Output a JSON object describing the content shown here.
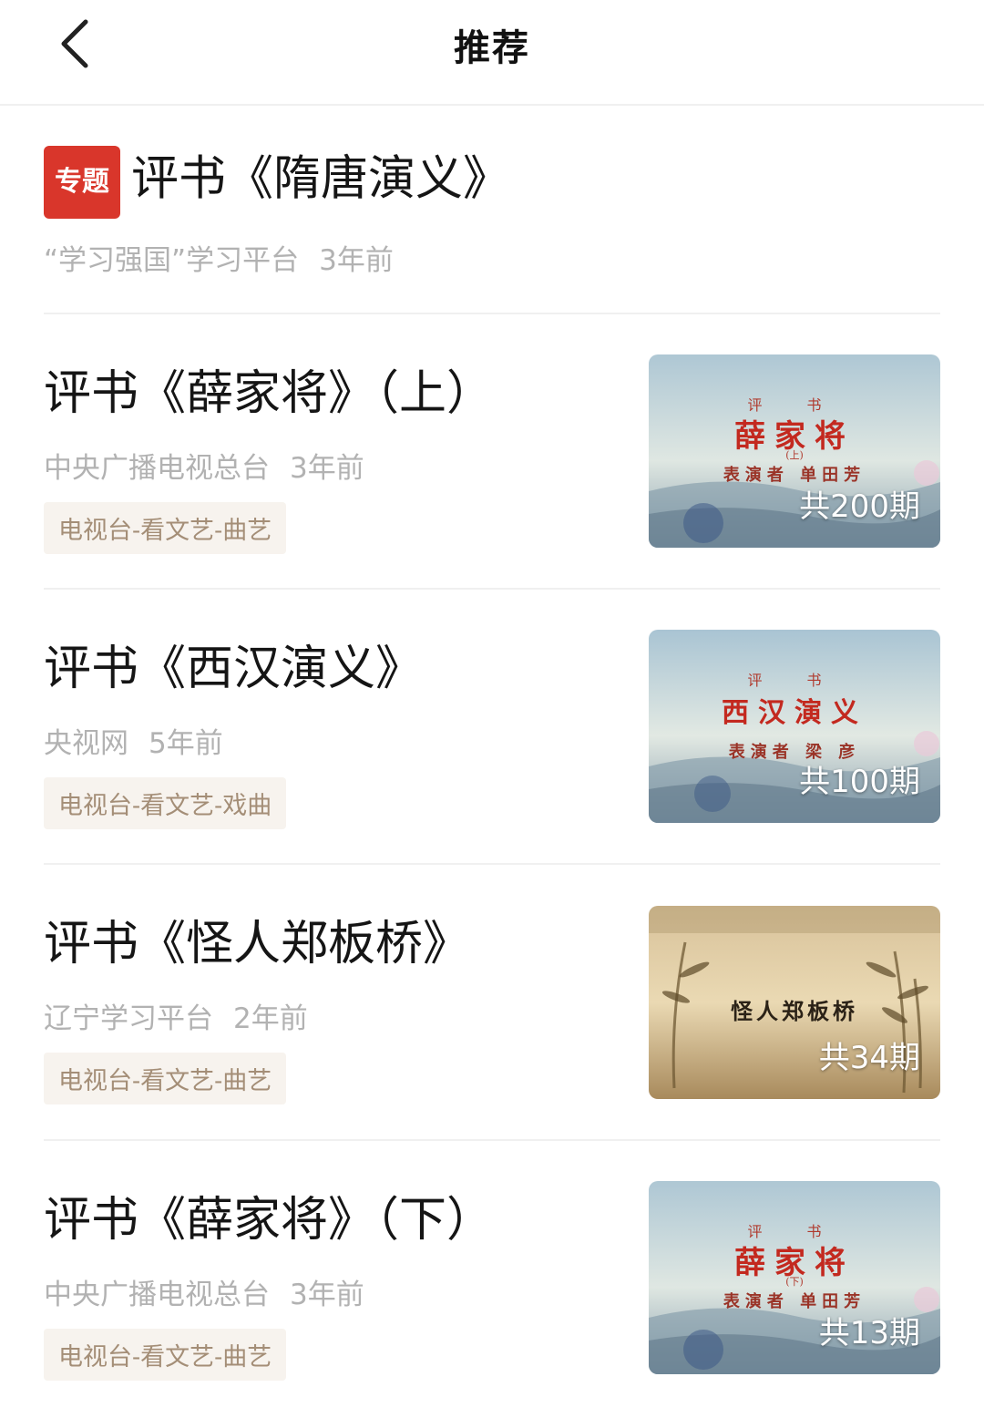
{
  "header": {
    "title": "推荐",
    "back_icon": "chevron-left-icon"
  },
  "topic": {
    "badge": "专题",
    "title": "评书《隋唐演义》",
    "source": "“学习强国”学习平台",
    "time": "3年前",
    "badge_color": "#d9362b"
  },
  "items": [
    {
      "title": "评书《薛家将》（上）",
      "source": "中央广播电视总台",
      "time": "3年前",
      "tag": "电视台-看文艺-曲艺",
      "count": "共200期",
      "thumb": {
        "small": "评 书",
        "main": "薛家将",
        "mark": "(上)",
        "sub": "表演者 单田芳"
      }
    },
    {
      "title": "评书《西汉演义》",
      "source": "央视网",
      "time": "5年前",
      "tag": "电视台-看文艺-戏曲",
      "count": "共100期",
      "thumb": {
        "small": "评 书",
        "main": "西汉演义",
        "sub": "表演者 梁 彦"
      }
    },
    {
      "title": "评书《怪人郑板桥》",
      "source": "辽宁学习平台",
      "time": "2年前",
      "tag": "电视台-看文艺-曲艺",
      "count": "共34期",
      "thumb": {
        "main": "怪人郑板桥"
      }
    },
    {
      "title": "评书《薛家将》（下）",
      "source": "中央广播电视总台",
      "time": "3年前",
      "tag": "电视台-看文艺-曲艺",
      "count": "共13期",
      "thumb": {
        "small": "评 书",
        "main": "薛家将",
        "mark": "(下)",
        "sub": "表演者 单田芳"
      }
    }
  ]
}
